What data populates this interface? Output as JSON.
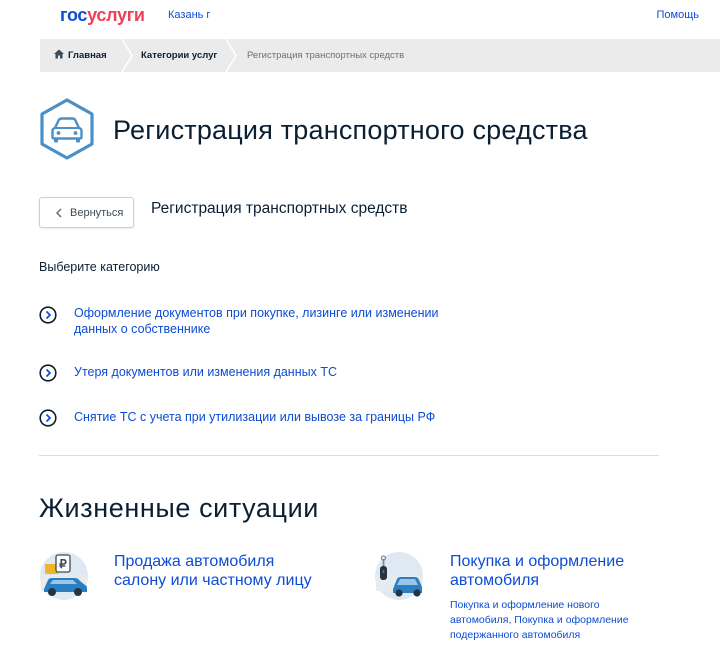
{
  "header": {
    "logo_part1": "гос",
    "logo_part2": "услуги",
    "city": "Казань г",
    "help": "Помощь"
  },
  "breadcrumbs": {
    "home": "Главная",
    "category": "Категории услуг",
    "current": "Регистрация транспортных средств"
  },
  "page": {
    "title": "Регистрация транспортного средства",
    "title_icon": "car-icon",
    "back_label": "Вернуться",
    "section_title": "Регистрация транспортных средств",
    "choose_label": "Выберите категорию"
  },
  "categories": [
    {
      "line1": "Оформление документов при покупке, лизинге или изменении",
      "line2": "данных о собственнике"
    },
    {
      "line1": "Утеря документов или изменения данных ТС",
      "line2": ""
    },
    {
      "line1": "Снятие ТС с учета при утилизации или вывозе за границы РФ",
      "line2": ""
    }
  ],
  "life_situations": {
    "title": "Жизненные ситуации",
    "items": [
      {
        "title_line1": "Продажа автомобиля",
        "title_line2": "салону или частному лицу",
        "desc_line1": "",
        "desc_line2": "",
        "desc_line3": "",
        "icon": "car-sale-icon"
      },
      {
        "title_line1": "Покупка и оформление",
        "title_line2": "автомобиля",
        "desc_line1": "Покупка и оформление нового",
        "desc_line2": "автомобиля, Покупка и оформление",
        "desc_line3": "подержанного автомобиля",
        "icon": "car-keys-icon"
      }
    ]
  },
  "colors": {
    "link": "#0d4cd3",
    "brand_red": "#ee3f58",
    "icon_blue": "#4a90c8",
    "text": "#0b1f33"
  }
}
